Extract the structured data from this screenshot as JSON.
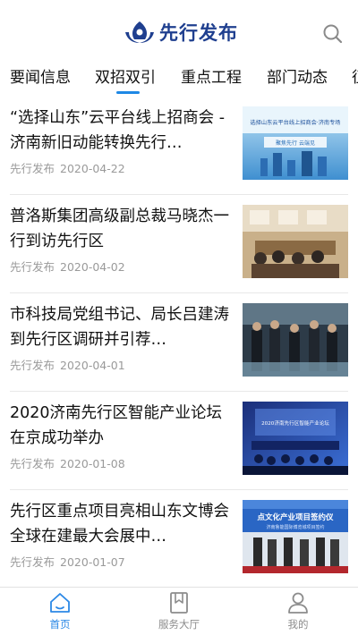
{
  "header": {
    "app_title": "先行发布",
    "logo_icon": "lotus-logo-icon",
    "search_icon": "search-icon"
  },
  "tabs": [
    {
      "label": "要闻信息",
      "active": false
    },
    {
      "label": "双招双引",
      "active": true
    },
    {
      "label": "重点工程",
      "active": false
    },
    {
      "label": "部门动态",
      "active": false
    },
    {
      "label": "征",
      "active": false
    }
  ],
  "articles": [
    {
      "title": "“选择山东”云平台线上招商会 - 济南新旧动能转换先行…",
      "source": "先行发布",
      "date": "2020-04-22"
    },
    {
      "title": "普洛斯集团高级副总裁马晓杰一行到访先行区",
      "source": "先行发布",
      "date": "2020-04-02"
    },
    {
      "title": "市科技局党组书记、局长吕建涛到先行区调研并引荐…",
      "source": "先行发布",
      "date": "2020-04-01"
    },
    {
      "title": "2020济南先行区智能产业论坛在京成功举办",
      "source": "先行发布",
      "date": "2020-01-08"
    },
    {
      "title": "先行区重点项目亮相山东文博会 全球在建最大会展中…",
      "source": "先行发布",
      "date": "2020-01-07"
    }
  ],
  "thumbnails": [
    {
      "banner_text": "选择山东云平台线上招商会·济南专场",
      "sub_text": "聚焦先行 云端见"
    },
    {
      "banner_text": "",
      "sub_text": ""
    },
    {
      "banner_text": "",
      "sub_text": ""
    },
    {
      "banner_text": "",
      "sub_text": "2020济南先行区智能产业论坛"
    },
    {
      "banner_text": "点文化产业项目签约仪",
      "sub_text": "济南鲁能国际博览城项目签约"
    }
  ],
  "bottom_nav": [
    {
      "label": "首页",
      "icon": "home-icon",
      "active": true
    },
    {
      "label": "服务大厅",
      "icon": "bookmark-icon",
      "active": false
    },
    {
      "label": "我的",
      "icon": "user-icon",
      "active": false
    }
  ],
  "colors": {
    "accent": "#2b88e6",
    "brand": "#1f3f8f",
    "tab_indicator": "#1e88e5",
    "meta_gray": "#9a9a9a"
  }
}
